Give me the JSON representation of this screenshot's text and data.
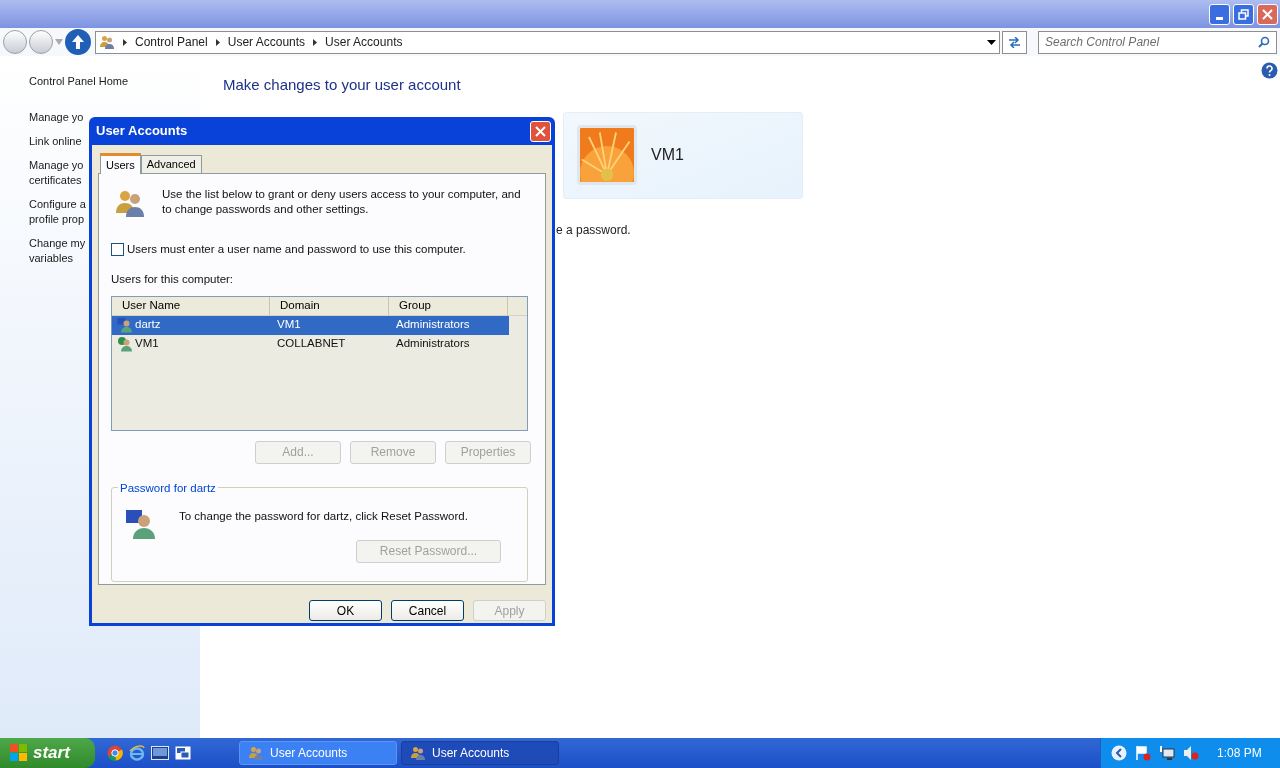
{
  "address_bar": {
    "breadcrumbs": [
      "Control Panel",
      "User Accounts",
      "User Accounts"
    ],
    "search_placeholder": "Search Control Panel"
  },
  "sidebar": {
    "items": [
      {
        "lines": [
          "Control Panel Home"
        ]
      },
      {
        "lines": [
          "Manage yo"
        ]
      },
      {
        "lines": [
          "Link online"
        ]
      },
      {
        "lines": [
          "Manage yo",
          "certificates"
        ]
      },
      {
        "lines": [
          "Configure a",
          "profile prop"
        ]
      },
      {
        "lines": [
          "Change my",
          "variables"
        ]
      }
    ]
  },
  "main": {
    "heading": "Make changes to your user account",
    "account_name": "VM1",
    "partial_text": "e a password."
  },
  "dialog": {
    "title": "User Accounts",
    "tabs": [
      {
        "label": "Users",
        "selected": true
      },
      {
        "label": "Advanced",
        "selected": false
      }
    ],
    "intro": "Use the list below to grant or deny users access to your computer, and to change passwords and other settings.",
    "checkbox": {
      "label": "Users must enter a user name and password to use this computer.",
      "checked": false
    },
    "users_label": "Users for this computer:",
    "columns": [
      "User Name",
      "Domain",
      "Group"
    ],
    "rows": [
      {
        "cells": [
          "dartz",
          "VM1",
          "Administrators"
        ],
        "selected": true
      },
      {
        "cells": [
          "VM1",
          "COLLABNET",
          "Administrators"
        ],
        "selected": false
      }
    ],
    "list_buttons": [
      {
        "label": "Add...",
        "disabled": true
      },
      {
        "label": "Remove",
        "disabled": true
      },
      {
        "label": "Properties",
        "disabled": true
      }
    ],
    "password_group": {
      "title": "Password for dartz",
      "text": "To change the password for dartz, click Reset Password.",
      "button": {
        "label": "Reset Password...",
        "disabled": true
      }
    },
    "footer_buttons": [
      {
        "label": "OK",
        "disabled": false
      },
      {
        "label": "Cancel",
        "disabled": false
      },
      {
        "label": "Apply",
        "disabled": true
      }
    ]
  },
  "taskbar": {
    "start": "start",
    "tasks": [
      {
        "label": "User Accounts",
        "selected": false
      },
      {
        "label": "User Accounts",
        "selected": true
      }
    ],
    "clock": "1:08 PM"
  }
}
